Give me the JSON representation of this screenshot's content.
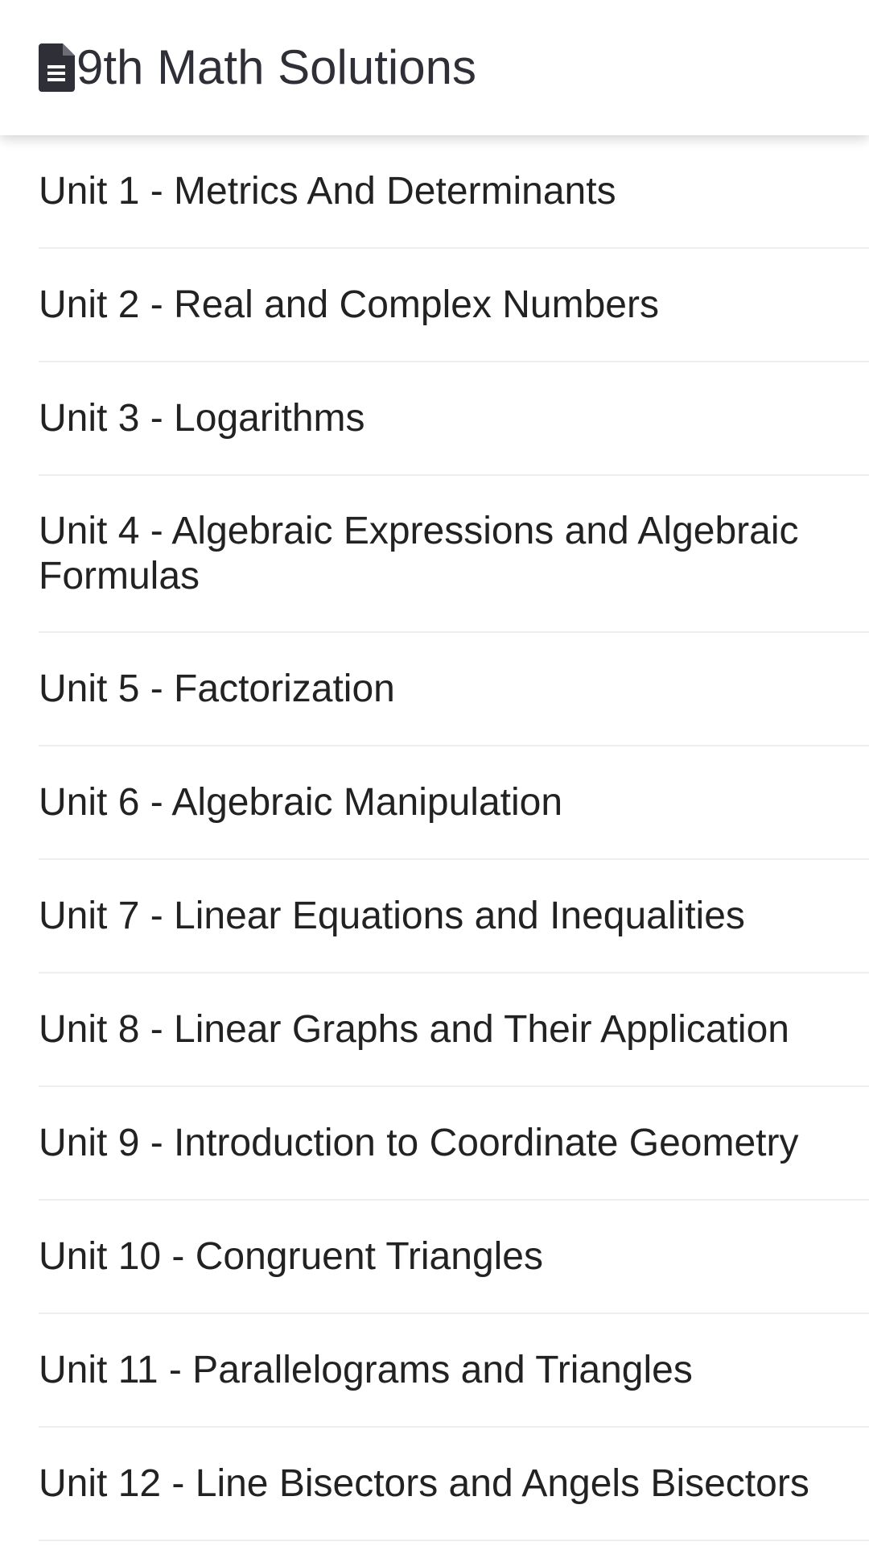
{
  "header": {
    "title": "9th Math Solutions",
    "icon": "document-icon"
  },
  "units": [
    {
      "label": "Unit 1 - Metrics And Determinants"
    },
    {
      "label": "Unit 2 - Real and Complex Numbers"
    },
    {
      "label": "Unit 3 - Logarithms"
    },
    {
      "label": "Unit 4 - Algebraic Expressions and Algebraic Formulas"
    },
    {
      "label": "Unit 5 - Factorization"
    },
    {
      "label": "Unit 6 - Algebraic Manipulation"
    },
    {
      "label": "Unit 7 - Linear Equations and Inequalities"
    },
    {
      "label": "Unit 8 - Linear Graphs and Their Application"
    },
    {
      "label": "Unit 9 - Introduction to Coordinate Geometry"
    },
    {
      "label": "Unit 10 - Congruent Triangles"
    },
    {
      "label": "Unit 11 - Parallelograms and Triangles"
    },
    {
      "label": "Unit 12 - Line Bisectors and Angels Bisectors"
    }
  ]
}
